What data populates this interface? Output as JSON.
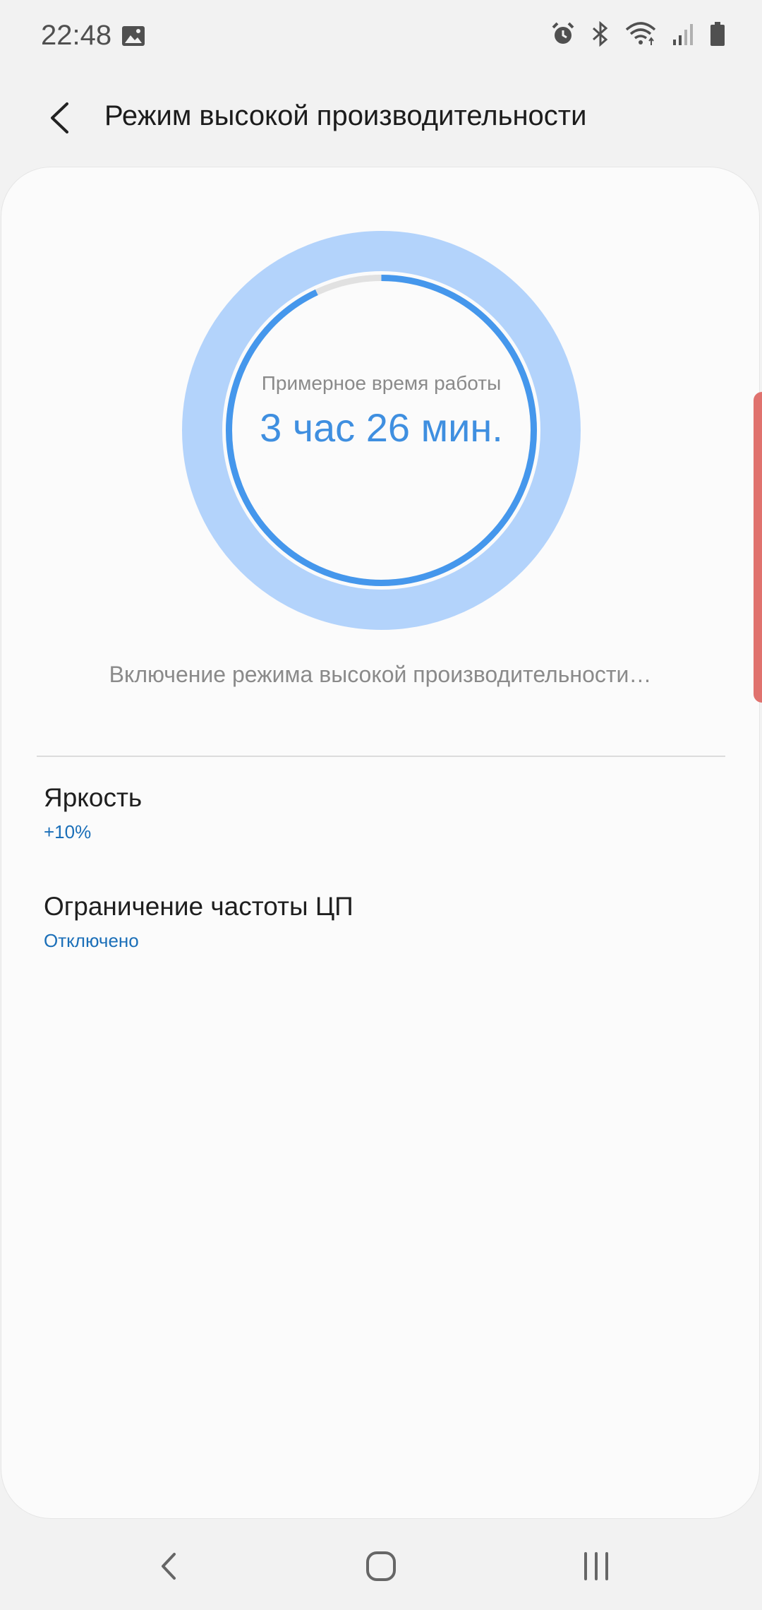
{
  "status_bar": {
    "time": "22:48",
    "icons": [
      "gallery-icon",
      "alarm-icon",
      "bluetooth-icon",
      "wifi-icon",
      "signal-icon",
      "battery-icon"
    ]
  },
  "header": {
    "title": "Режим высокой производительности",
    "back_icon": "back-arrow-icon"
  },
  "battery_estimate": {
    "label": "Примерное время работы",
    "value": "3 час 26 мин.",
    "ring_progress": 0.93,
    "colors": {
      "outer": "#b3d3fb",
      "progress": "#4597ec",
      "track": "#e1e1e1"
    }
  },
  "status_message": "Включение режима высокой производительности…",
  "settings": [
    {
      "title": "Яркость",
      "value": "+10%"
    },
    {
      "title": "Ограничение частоты ЦП",
      "value": "Отключено"
    }
  ],
  "nav_bar": {
    "icons": [
      "nav-back-icon",
      "home-icon",
      "recents-icon"
    ]
  },
  "accent_color": "#1b6fb8"
}
